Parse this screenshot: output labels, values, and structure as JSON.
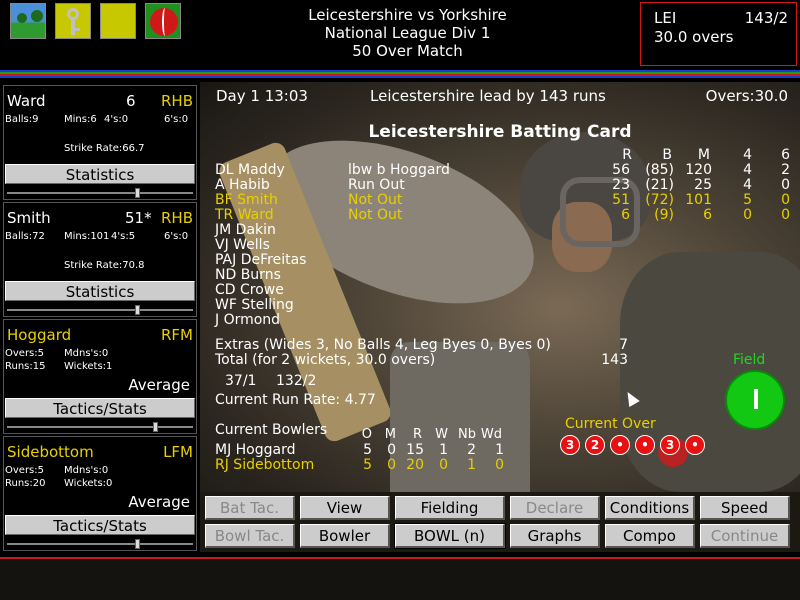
{
  "header": {
    "match_title": "Leicestershire vs Yorkshire",
    "league": "National League Div 1",
    "match_type": "50 Over Match",
    "score": {
      "team": "LEI",
      "runs": "143/2",
      "overs": "30.0 overs"
    },
    "icons": [
      "landscape-icon",
      "key-icon",
      "blank-icon",
      "cricket-ball-icon"
    ]
  },
  "left_panel": {
    "batsman1": {
      "name": "Ward",
      "runs": "6",
      "style": "RHB",
      "balls": "Balls:9",
      "mins": "Mins:6",
      "fours": "4's:0",
      "sixes": "6's:0",
      "strike_rate": "Strike Rate:66.7",
      "button": "Statistics"
    },
    "batsman2": {
      "name": "Smith",
      "runs": "51*",
      "style": "RHB",
      "balls": "Balls:72",
      "mins": "Mins:101",
      "fours": "4's:5",
      "sixes": "6's:0",
      "strike_rate": "Strike Rate:70.8",
      "button": "Statistics"
    },
    "bowler1": {
      "name": "Hoggard",
      "style": "RFM",
      "overs": "Overs:5",
      "maidens": "Mdns's:0",
      "runs": "Runs:15",
      "wickets": "Wickets:1",
      "mode": "Average",
      "button": "Tactics/Stats"
    },
    "bowler2": {
      "name": "Sidebottom",
      "style": "LFM",
      "overs": "Overs:5",
      "maidens": "Mdns's:0",
      "runs": "Runs:20",
      "wickets": "Wickets:0",
      "mode": "Average",
      "button": "Tactics/Stats"
    }
  },
  "main": {
    "day_time": "Day  1 13:03",
    "lead": "Leicestershire lead by 143 runs",
    "overs": "Overs:30.0",
    "card_title": "Leicestershire Batting Card",
    "columns": [
      "R",
      "B",
      "M",
      "4",
      "6"
    ],
    "batsmen": [
      {
        "name": "DL Maddy",
        "how": "lbw b Hoggard",
        "r": "56",
        "b": "(85)",
        "m": "120",
        "f": "4",
        "s": "2"
      },
      {
        "name": "A Habib",
        "how": "Run Out",
        "r": "23",
        "b": "(21)",
        "m": "25",
        "f": "4",
        "s": "0"
      },
      {
        "name": "BF Smith",
        "how": "Not Out",
        "r": "51",
        "b": "(72)",
        "m": "101",
        "f": "5",
        "s": "0"
      },
      {
        "name": "TR Ward",
        "how": "Not Out",
        "r": "6",
        "b": "(9)",
        "m": "6",
        "f": "0",
        "s": "0"
      },
      {
        "name": "JM Dakin"
      },
      {
        "name": "VJ Wells"
      },
      {
        "name": "PAJ DeFreitas"
      },
      {
        "name": "ND Burns"
      },
      {
        "name": "CD Crowe"
      },
      {
        "name": "WF Stelling"
      },
      {
        "name": "J Ormond"
      }
    ],
    "extras_label": "Extras (Wides 3, No Balls 4, Leg Byes 0, Byes 0)",
    "extras_value": "7",
    "total_label": "Total (for 2 wickets, 30.0 overs)",
    "total_value": "143",
    "fall_of_wickets": [
      "37/1",
      "132/2"
    ],
    "run_rate": "Current Run Rate: 4.77",
    "field_label": "Field",
    "current_over_label": "Current Over",
    "current_over": [
      "3",
      "2",
      "•",
      "•",
      "3",
      "•"
    ],
    "bowlers_label": "Current Bowlers",
    "bowler_columns": [
      "O",
      "M",
      "R",
      "W",
      "Nb",
      "Wd"
    ],
    "bowlers": [
      {
        "name": "MJ Hoggard",
        "o": "5",
        "m": "0",
        "r": "15",
        "w": "1",
        "nb": "2",
        "wd": "1"
      },
      {
        "name": "RJ Sidebottom",
        "o": "5",
        "m": "0",
        "r": "20",
        "w": "0",
        "nb": "1",
        "wd": "0"
      }
    ]
  },
  "buttons": {
    "bat_tac": "Bat Tac.",
    "view": "View",
    "fielding": "Fielding",
    "declare": "Declare",
    "conditions": "Conditions",
    "speed": "Speed",
    "bowl_tac": "Bowl Tac.",
    "bowler": "Bowler",
    "bowl": "BOWL (n)",
    "graphs": "Graphs",
    "compo": "Compo",
    "continue": "Continue"
  },
  "colors": {
    "highlight": "#e8d000",
    "accent_red": "#d01818",
    "field_green": "#12c812"
  }
}
